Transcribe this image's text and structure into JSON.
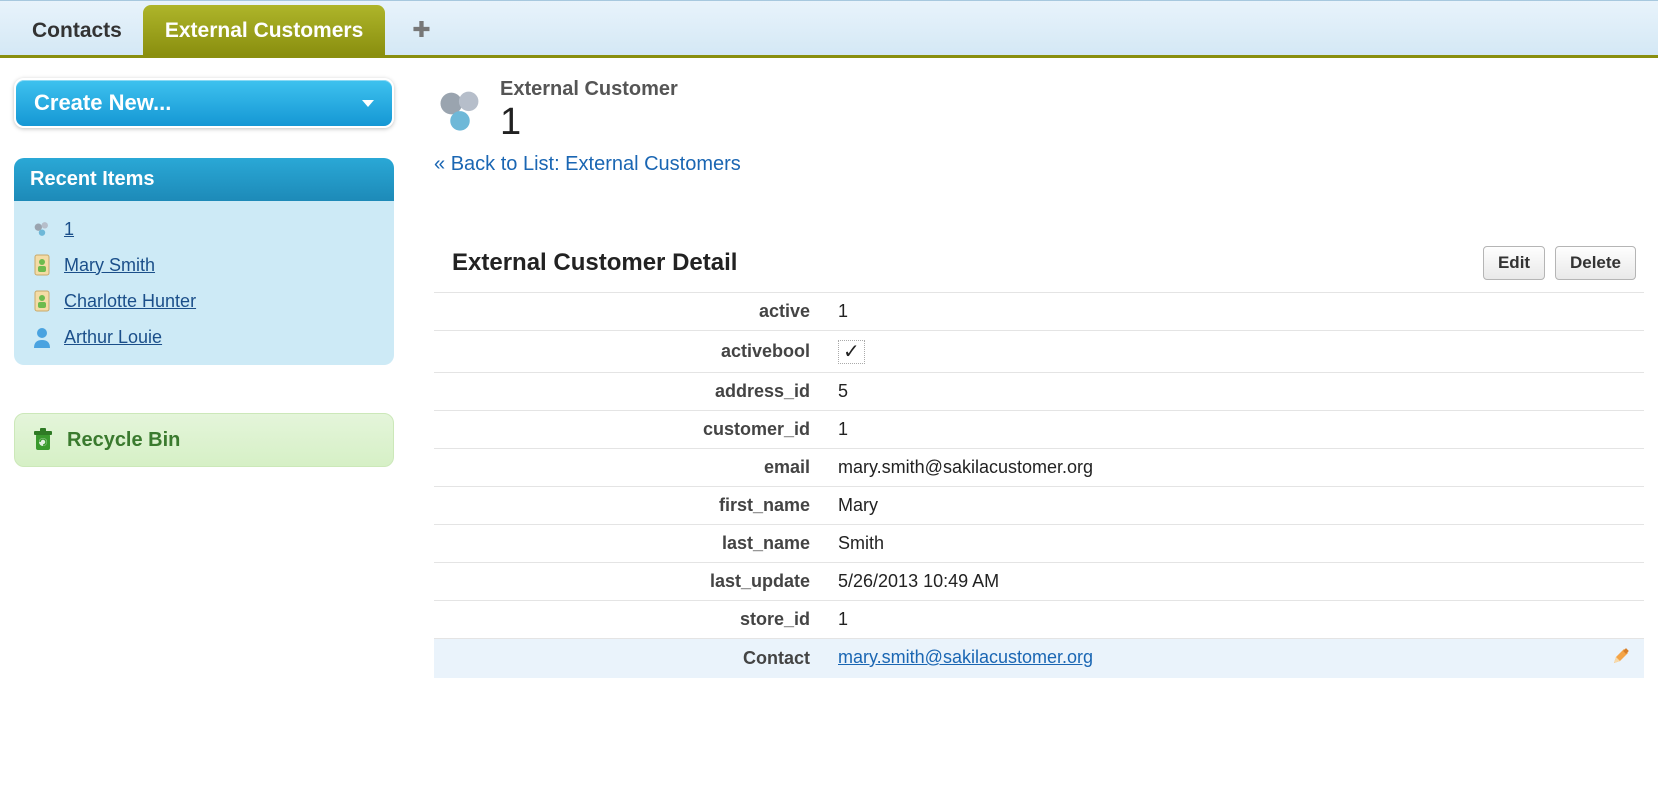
{
  "tabs": {
    "contacts": "Contacts",
    "external_customers": "External Customers"
  },
  "sidebar": {
    "create_new": "Create New...",
    "recent_header": "Recent Items",
    "recent": [
      {
        "label": "1",
        "icon": "gears"
      },
      {
        "label": "Mary Smith",
        "icon": "contact"
      },
      {
        "label": "Charlotte Hunter",
        "icon": "contact"
      },
      {
        "label": "Arthur Louie",
        "icon": "person"
      }
    ],
    "recycle_bin": "Recycle Bin"
  },
  "record": {
    "type_label": "External Customer",
    "title": "1",
    "back_prefix": "« ",
    "back_link": "Back to List: External Customers"
  },
  "detail": {
    "heading": "External Customer Detail",
    "edit": "Edit",
    "delete": "Delete",
    "fields": {
      "active": {
        "label": "active",
        "value": "1"
      },
      "activebool": {
        "label": "activebool",
        "value": "✓"
      },
      "address_id": {
        "label": "address_id",
        "value": "5"
      },
      "customer_id": {
        "label": "customer_id",
        "value": "1"
      },
      "email": {
        "label": "email",
        "value": "mary.smith@sakilacustomer.org"
      },
      "first_name": {
        "label": "first_name",
        "value": "Mary"
      },
      "last_name": {
        "label": "last_name",
        "value": "Smith"
      },
      "last_update": {
        "label": "last_update",
        "value": "5/26/2013 10:49 AM"
      },
      "store_id": {
        "label": "store_id",
        "value": "1"
      },
      "contact": {
        "label": "Contact",
        "value": "mary.smith@sakilacustomer.org"
      }
    }
  }
}
